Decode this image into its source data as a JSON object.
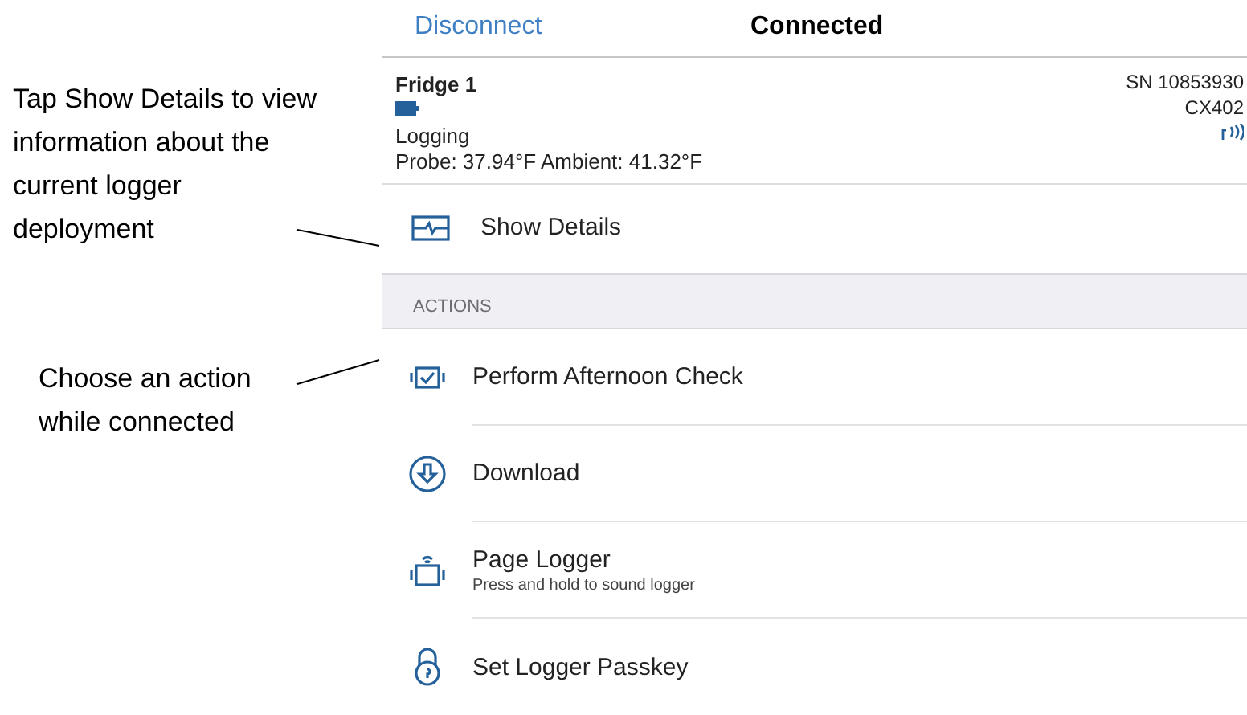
{
  "annotations": [
    {
      "text": "Tap Show Details to view information about the current logger deployment"
    },
    {
      "text": "Choose an action while connected"
    }
  ],
  "nav": {
    "left_button": "Disconnect",
    "title": "Connected"
  },
  "device": {
    "name": "Fridge 1",
    "status": "Logging",
    "readings": "Probe: 37.94°F Ambient: 41.32°F",
    "serial": "SN 10853930",
    "model": "CX402"
  },
  "details_button": "Show Details",
  "actions_header": "ACTIONS",
  "actions": [
    {
      "label": "Perform Afternoon Check"
    },
    {
      "label": "Download"
    },
    {
      "label": "Page Logger",
      "subtitle": "Press and hold to sound logger"
    },
    {
      "label": "Set Logger Passkey"
    }
  ]
}
